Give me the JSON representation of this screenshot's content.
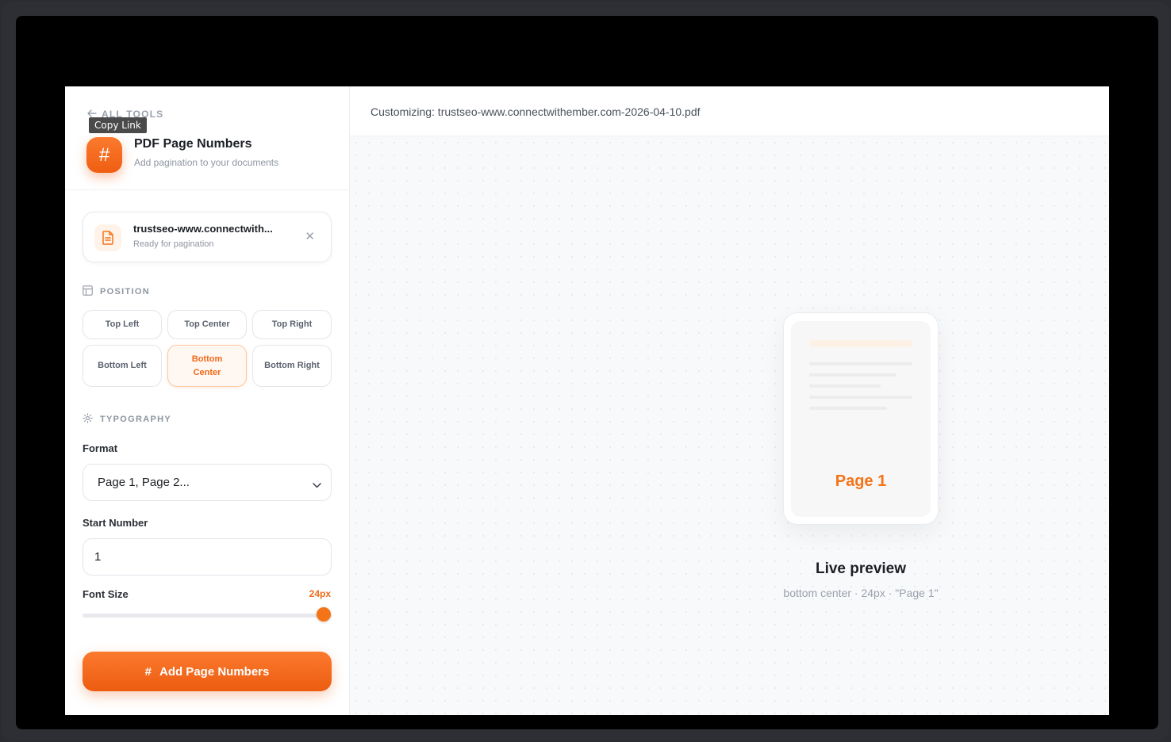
{
  "nav": {
    "back_label": "ALL TOOLS",
    "tooltip": "Copy Link"
  },
  "tool": {
    "title": "PDF Page Numbers",
    "subtitle": "Add pagination to your documents",
    "icon": "hash-icon"
  },
  "file": {
    "name": "trustseo-www.connectwith...",
    "status": "Ready for pagination"
  },
  "position": {
    "heading": "POSITION",
    "options": [
      "Top Left",
      "Top Center",
      "Top Right",
      "Bottom Left",
      "Bottom Center",
      "Bottom Right"
    ],
    "selected": "Bottom Center"
  },
  "typography": {
    "heading": "TYPOGRAPHY",
    "format_label": "Format",
    "format_value": "Page 1, Page 2...",
    "start_label": "Start Number",
    "start_value": "1",
    "size_label": "Font Size",
    "size_value": "24px",
    "size_level": 1.0
  },
  "action": {
    "label": "Add Page Numbers"
  },
  "header": {
    "customizing": "Customizing: trustseo-www.connectwithember.com-2026-04-10.pdf"
  },
  "preview": {
    "page_label": "Page 1",
    "title": "Live preview",
    "details": "bottom center · 24px · \"Page 1\""
  },
  "colors": {
    "accent": "#f47417",
    "accent_light": "#fff8f2"
  }
}
